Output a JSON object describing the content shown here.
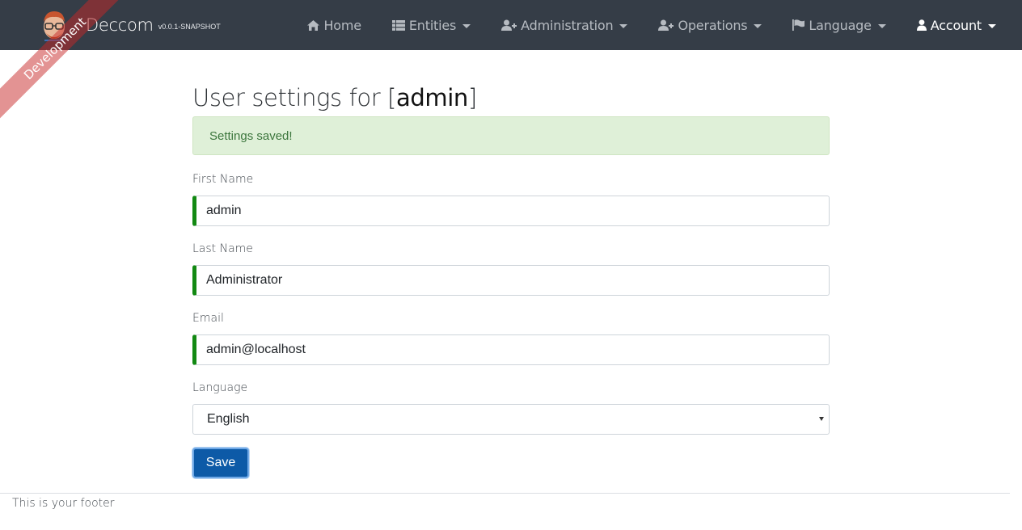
{
  "brand": {
    "title": "Deccom",
    "version": "v0.0.1-SNAPSHOT",
    "ribbon": "Development"
  },
  "nav": {
    "items": [
      {
        "label": "Home",
        "icon": "home-icon",
        "dropdown": false
      },
      {
        "label": "Entities",
        "icon": "th-list-icon",
        "dropdown": true
      },
      {
        "label": "Administration",
        "icon": "user-plus-icon",
        "dropdown": true
      },
      {
        "label": "Operations",
        "icon": "user-plus-icon",
        "dropdown": true
      },
      {
        "label": "Language",
        "icon": "flag-icon",
        "dropdown": true
      },
      {
        "label": "Account",
        "icon": "user-icon",
        "dropdown": true,
        "active": true
      }
    ]
  },
  "page": {
    "title_prefix": "User settings for [",
    "username": "admin",
    "title_suffix": "]"
  },
  "alert": {
    "message": "Settings saved!"
  },
  "form": {
    "first_name": {
      "label": "First Name",
      "value": "admin"
    },
    "last_name": {
      "label": "Last Name",
      "value": "Administrator"
    },
    "email": {
      "label": "Email",
      "value": "admin@localhost"
    },
    "language": {
      "label": "Language",
      "value": "English"
    },
    "save_label": "Save"
  },
  "footer": {
    "text": "This is your footer"
  },
  "colors": {
    "navbar": "#353d47",
    "alert_bg": "#dff0d8",
    "alert_text": "#3c763d",
    "valid_border": "#128912",
    "primary": "#0d5aa7"
  }
}
